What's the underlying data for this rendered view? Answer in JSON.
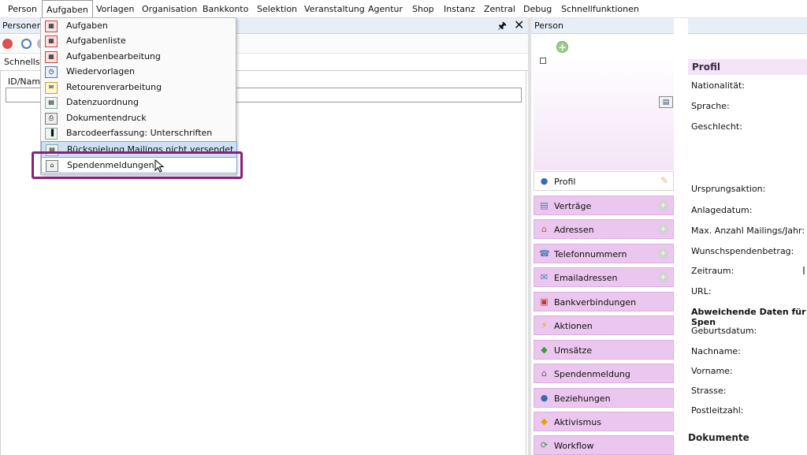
{
  "menubar": {
    "items": [
      "Person",
      "Aufgaben",
      "Vorlagen",
      "Organisation",
      "Bankkonto",
      "Selektion",
      "Veranstaltung",
      "Agentur",
      "Shop",
      "Instanz",
      "Zentral",
      "Debug",
      "Schnellfunktionen"
    ],
    "active": "Aufgaben"
  },
  "left_pane": {
    "title": "Personensu",
    "tab": "Schnellsuc",
    "id_label": "ID/Name",
    "id_value": ""
  },
  "dropdown": {
    "items": [
      "Aufgaben",
      "Aufgabenliste",
      "Aufgabenbearbeitung",
      "Wiedervorlagen",
      "Retourenverarbeitung",
      "Datenzuordnung",
      "Dokumentendruck",
      "Barcodeerfassung: Unterschriften",
      "Rückspielung Mailings nicht versendet",
      "Spendenmeldungen"
    ],
    "selected": "Rückspielung Mailings nicht versendet",
    "hovered": "Spendenmeldungen"
  },
  "right_pane": {
    "title": "Person",
    "nav": [
      "Profil",
      "Verträge",
      "Adressen",
      "Telefonnummern",
      "Emailadressen",
      "Bankverbindungen",
      "Aktionen",
      "Umsätze",
      "Spendenmeldung",
      "Beziehungen",
      "Aktivismus",
      "Workflow"
    ],
    "nav_active": "Profil",
    "profil_title": "Profil",
    "fields": [
      "Nationalität:",
      "Sprache:",
      "Geschlecht:",
      "Ursprungsaktion:",
      "Anlagedatum:",
      "Max. Anzahl Mailings/Jahr:",
      "Wunschspendenbetrag:",
      "Zeitraum:",
      "URL:"
    ],
    "section_abweichend": "Abweichende Daten für Spen",
    "fields2": [
      "Geburtsdatum:",
      "Nachname:",
      "Vorname:",
      "Strasse:",
      "Postleitzahl:"
    ],
    "dokumente": "Dokumente"
  },
  "colors": {
    "highlight_box": "#8b1e7a",
    "nav_bg": "#ebc6ee",
    "selected_item_bg": "#cfe0f4"
  }
}
